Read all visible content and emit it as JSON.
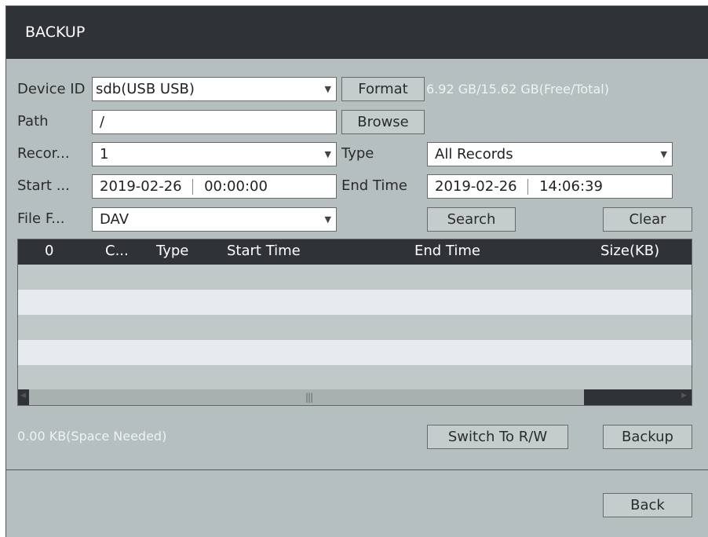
{
  "window": {
    "title": "BACKUP"
  },
  "form": {
    "device_id_label": "Device ID",
    "device_id_value": "sdb(USB USB)",
    "format_label": "Format",
    "capacity_text": "6.92 GB/15.62 GB(Free/Total)",
    "path_label": "Path",
    "path_value": "/",
    "browse_label": "Browse",
    "record_label": "Recor...",
    "record_value": "1",
    "type_label": "Type",
    "type_value": "All Records",
    "start_label": "Start ...",
    "start_date": "2019-02-26",
    "start_time": "00:00:00",
    "end_label": "End Time",
    "end_date": "2019-02-26",
    "end_time": "14:06:39",
    "file_format_label": "File F...",
    "file_format_value": "DAV",
    "search_label": "Search",
    "clear_label": "Clear"
  },
  "table": {
    "columns": [
      "0",
      "C...",
      "Type",
      "Start Time",
      "End Time",
      "Size(KB)"
    ],
    "rows": []
  },
  "footer": {
    "space_needed": "0.00 KB(Space Needed)",
    "switch_label": "Switch To R/W",
    "backup_label": "Backup",
    "back_label": "Back"
  },
  "icons": {
    "dropdown": "chevron-down-icon",
    "scroll_left": "scroll-left-icon",
    "scroll_right": "scroll-right-icon"
  }
}
